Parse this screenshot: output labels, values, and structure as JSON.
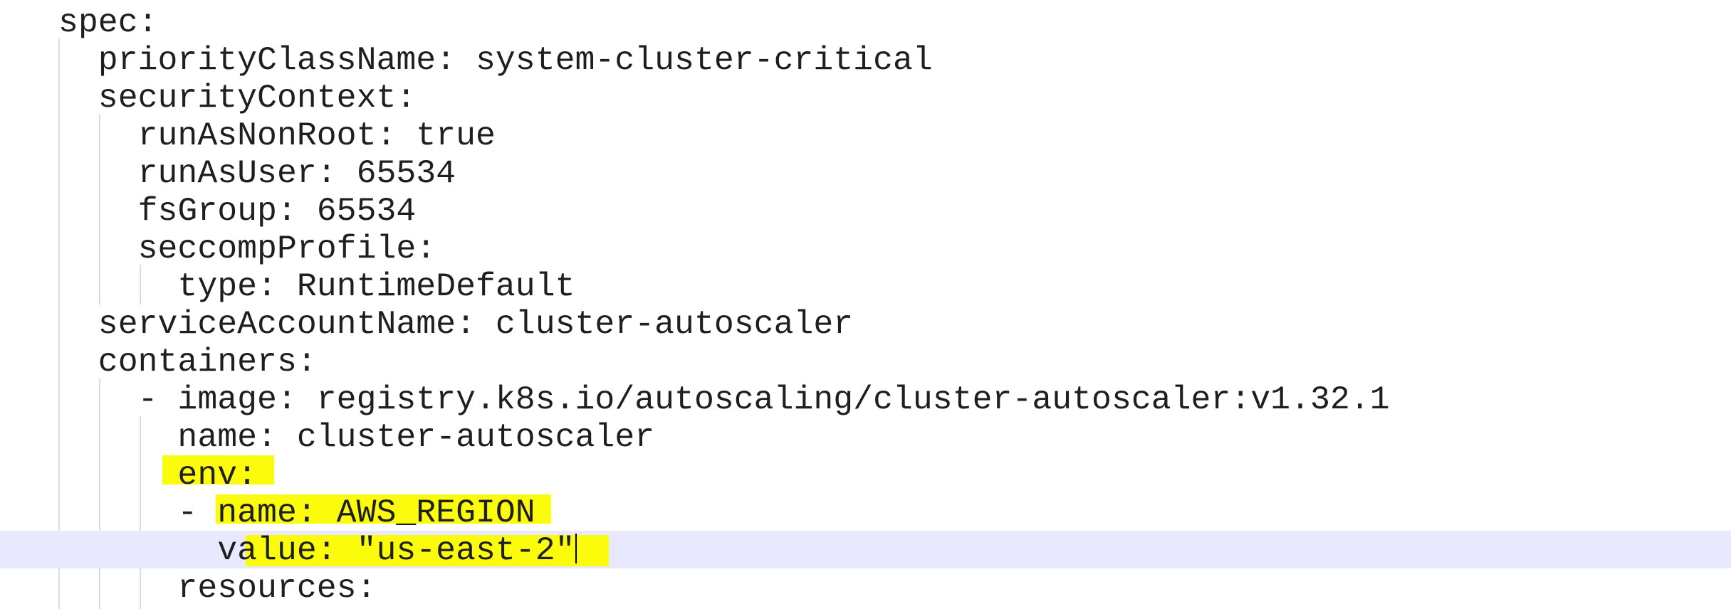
{
  "editor": {
    "lines": [
      "spec:",
      "  priorityClassName: system-cluster-critical",
      "  securityContext:",
      "    runAsNonRoot: true",
      "    runAsUser: 65534",
      "    fsGroup: 65534",
      "    seccompProfile:",
      "      type: RuntimeDefault",
      "  serviceAccountName: cluster-autoscaler",
      "  containers:",
      "    - image: registry.k8s.io/autoscaling/cluster-autoscaler:v1.32.1",
      "      name: cluster-autoscaler",
      "      env:",
      "      - name: AWS_REGION",
      "        value: \"us-east-2\"",
      "      resources:"
    ],
    "current_line_index": 14,
    "highlight_color": "#fbfb0c",
    "current_line_color": "#e8e8ff"
  }
}
